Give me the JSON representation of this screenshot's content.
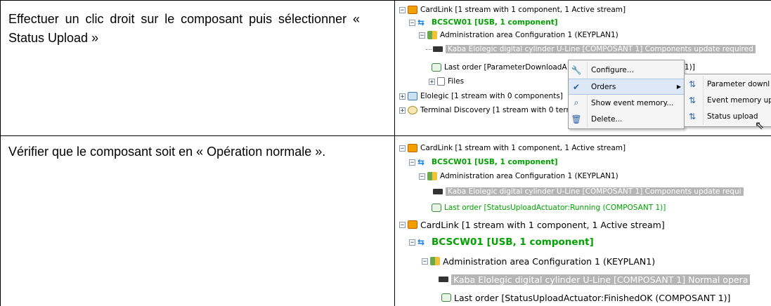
{
  "rows": [
    {
      "instruction": "Effectuer un clic droit sur le composant puis sélectionner « Status Upload »",
      "tree": {
        "cardlink": "CardLink [1 stream with 1 component, 1 Active stream]",
        "reader": "BCSCW01 [USB, 1 component]",
        "admin": "Administration area Configuration 1 (KEYPLAN1)",
        "component": "Kaba Elolegic digital cylinder U-Line [COMPOSANT 1] Components update required",
        "last_order": "Last order [ParameterDownloadA",
        "last_order_tail": "1)]",
        "files": "Files",
        "elolegic": "Elolegic [1 stream with 0 components]",
        "terminal": "Terminal Discovery [1 stream with 0 term"
      },
      "context_menu": [
        "Configure...",
        "Orders",
        "Show event memory...",
        "Delete..."
      ],
      "submenu": [
        "Parameter downl",
        "Event memory up",
        "Status upload"
      ]
    },
    {
      "instruction": "Vérifier que le composant soit en « Opération normale ».",
      "tree_before": {
        "cardlink": "CardLink [1 stream with 1 component, 1 Active stream]",
        "reader": "BCSCW01 [USB, 1 component]",
        "admin": "Administration area Configuration 1 (KEYPLAN1)",
        "component": "Kaba Elolegic digital cylinder U-Line [COMPOSANT 1] Components update requi",
        "last_order": "Last order [StatusUploadActuator:Running (COMPOSANT 1)]"
      },
      "tree_after": {
        "cardlink": "CardLink [1 stream with 1 component, 1 Active stream]",
        "reader": "BCSCW01 [USB, 1 component]",
        "admin": "Administration area Configuration 1 (KEYPLAN1)",
        "component": "Kaba Elolegic digital cylinder U-Line [COMPOSANT 1] Normal opera",
        "last_order": "Last order [StatusUploadActuator:FinishedOK (COMPOSANT 1)]"
      }
    }
  ]
}
